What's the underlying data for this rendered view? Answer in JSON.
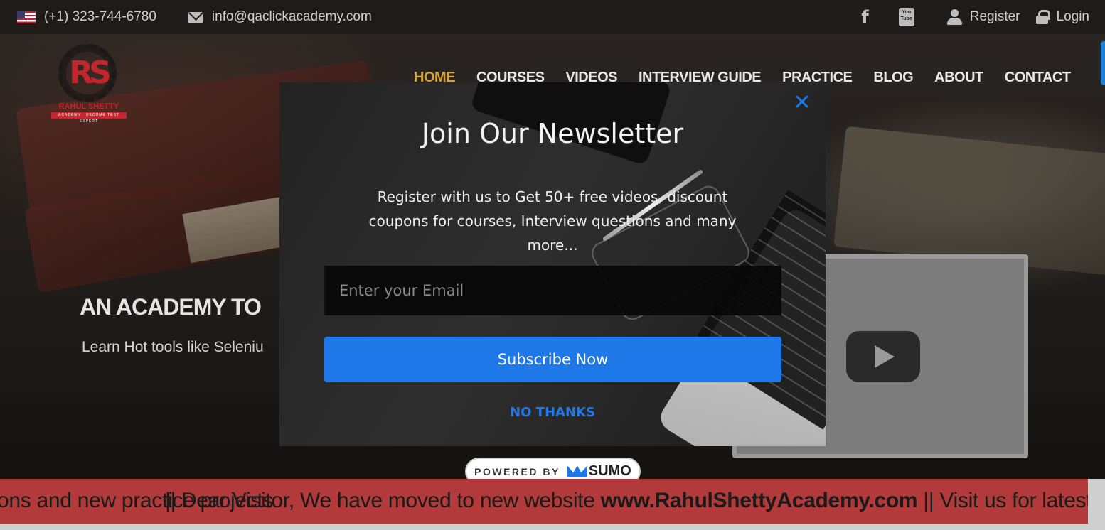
{
  "topbar": {
    "phone": "(+1) 323-744-6780",
    "email": "info@qaclickacademy.com",
    "register": "Register",
    "login": "Login",
    "facebook_icon": "f",
    "youtube_icon": "You Tube"
  },
  "logo": {
    "initials": "RS",
    "name": "RAHUL SHETTY",
    "tagline": "ACADEMY · BECOME TEST EXPERT"
  },
  "nav": {
    "items": [
      "HOME",
      "COURSES",
      "VIDEOS",
      "INTERVIEW GUIDE",
      "PRACTICE",
      "BLOG",
      "ABOUT",
      "CONTACT"
    ],
    "active": "HOME"
  },
  "hero": {
    "headline": "AN ACADEMY TO",
    "subline": "Learn Hot tools like Seleniu"
  },
  "modal": {
    "close": "✕",
    "title": "Join Our Newsletter",
    "description": "Register with us to Get 50+ free videos, discount coupons for courses, Interview questions and many more...",
    "email_placeholder": "Enter your Email",
    "subscribe_label": "Subscribe Now",
    "no_thanks_label": "NO THANKS"
  },
  "powered_by": {
    "label": "POWERED BY",
    "brand": "SUMO"
  },
  "ticker": {
    "trailing_text": "ons and new practice projects",
    "lead": "|| Dear Visitor, We have moved to new website ",
    "url": "www.RahulShettyAcademy.com",
    "tail": " || Visit us for latest"
  },
  "colors": {
    "accent": "#1e78e8",
    "nav_active": "#d4a53a",
    "ticker_bg": "#b23a3a",
    "brand_red": "#c0262b"
  }
}
